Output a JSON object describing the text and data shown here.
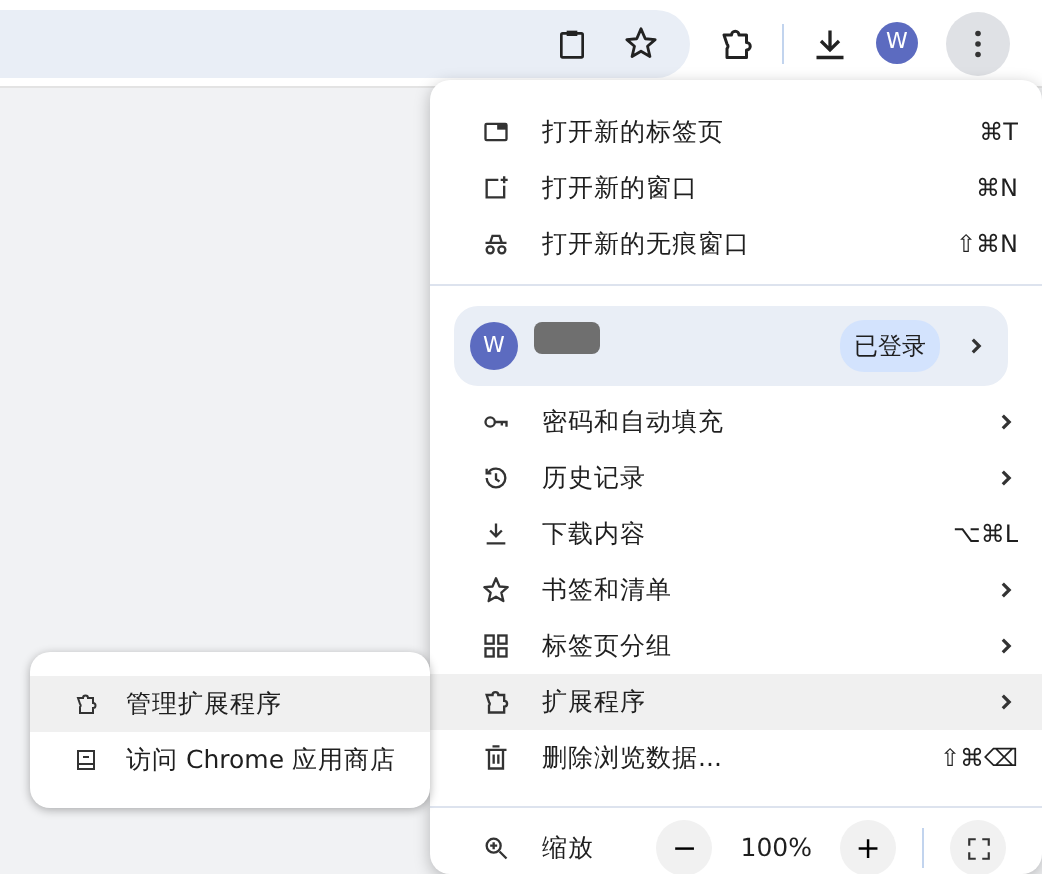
{
  "toolbar": {
    "avatar_letter": "W"
  },
  "menu": {
    "items": [
      {
        "kind": "item",
        "label": "打开新的标签页",
        "shortcut": "⌘T",
        "has_submenu": false,
        "selected": false
      },
      {
        "kind": "item",
        "label": "打开新的窗口",
        "shortcut": "⌘N",
        "has_submenu": false,
        "selected": false
      },
      {
        "kind": "item",
        "label": "打开新的无痕窗口",
        "shortcut": "⇧⌘N",
        "has_submenu": false,
        "selected": false
      },
      {
        "kind": "divider"
      },
      {
        "kind": "profile",
        "avatar_letter": "W",
        "status": "已登录",
        "has_submenu": true,
        "selected": false
      },
      {
        "kind": "item",
        "label": "密码和自动填充",
        "has_submenu": true,
        "selected": false
      },
      {
        "kind": "item",
        "label": "历史记录",
        "has_submenu": true,
        "selected": false
      },
      {
        "kind": "item",
        "label": "下载内容",
        "shortcut": "⌥⌘L",
        "has_submenu": false,
        "selected": false
      },
      {
        "kind": "item",
        "label": "书签和清单",
        "has_submenu": true,
        "selected": false
      },
      {
        "kind": "item",
        "label": "标签页分组",
        "has_submenu": true,
        "selected": false
      },
      {
        "kind": "item",
        "label": "扩展程序",
        "has_submenu": true,
        "selected": true
      },
      {
        "kind": "item",
        "label": "删除浏览数据...",
        "shortcut": "⇧⌘⌫",
        "has_submenu": false,
        "selected": false
      },
      {
        "kind": "divider"
      },
      {
        "kind": "zoom",
        "label": "缩放",
        "minus": "−",
        "value": "100%",
        "plus": "+"
      }
    ]
  },
  "submenu": {
    "items": [
      {
        "label": "管理扩展程序",
        "selected": true
      },
      {
        "label": "访问 Chrome 应用商店",
        "selected": false
      }
    ]
  }
}
